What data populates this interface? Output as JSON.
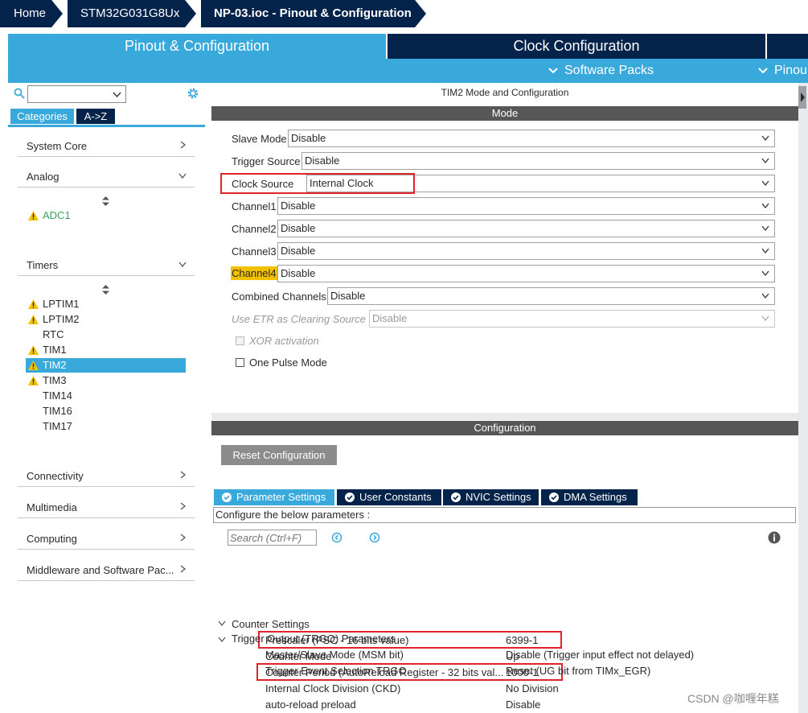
{
  "breadcrumb": {
    "home": "Home",
    "device": "STM32G031G8Ux",
    "project": "NP-03.ioc - Pinout & Configuration"
  },
  "tabs": {
    "pinout": "Pinout & Configuration",
    "clock": "Clock Configuration",
    "software_packs": "Software Packs",
    "pinout_menu": "Pinou"
  },
  "sidebar": {
    "search_value": "",
    "tab_categories": "Categories",
    "tab_az": "A->Z",
    "categories": {
      "system_core": "System Core",
      "analog": "Analog",
      "timers": "Timers",
      "connectivity": "Connectivity",
      "multimedia": "Multimedia",
      "computing": "Computing",
      "middleware": "Middleware and Software Pac..."
    },
    "analog_items": [
      {
        "label": "ADC1",
        "warning": true
      }
    ],
    "timer_items": [
      {
        "label": "LPTIM1",
        "warning": true
      },
      {
        "label": "LPTIM2",
        "warning": true
      },
      {
        "label": "RTC",
        "warning": false
      },
      {
        "label": "TIM1",
        "warning": true
      },
      {
        "label": "TIM2",
        "warning": true,
        "selected": true
      },
      {
        "label": "TIM3",
        "warning": true
      },
      {
        "label": "TIM14",
        "warning": false
      },
      {
        "label": "TIM16",
        "warning": false
      },
      {
        "label": "TIM17",
        "warning": false
      }
    ]
  },
  "mode": {
    "header": "TIM2 Mode and Configuration",
    "title": "Mode",
    "fields": {
      "slave_mode": {
        "label": "Slave Mode",
        "value": "Disable"
      },
      "trigger_source": {
        "label": "Trigger Source",
        "value": "Disable"
      },
      "clock_source": {
        "label": "Clock Source",
        "value": "Internal Clock"
      },
      "channel1": {
        "label": "Channel1",
        "value": "Disable"
      },
      "channel2": {
        "label": "Channel2",
        "value": "Disable"
      },
      "channel3": {
        "label": "Channel3",
        "value": "Disable"
      },
      "channel4": {
        "label": "Channel4",
        "value": "Disable"
      },
      "combined": {
        "label": "Combined Channels",
        "value": "Disable"
      },
      "etr": {
        "label": "Use ETR as Clearing Source",
        "value": "Disable"
      }
    },
    "xor_label": "XOR activation",
    "one_pulse_label": "One Pulse Mode"
  },
  "config": {
    "title": "Configuration",
    "reset_button": "Reset Configuration",
    "tabs": {
      "parameter": "Parameter Settings",
      "user_constants": "User Constants",
      "nvic": "NVIC Settings",
      "dma": "DMA Settings"
    },
    "hint": "Configure the below parameters :",
    "search_placeholder": "Search (Ctrl+F)",
    "groups": {
      "counter": "Counter Settings",
      "trgo": "Trigger Output (TRGO) Parameters"
    },
    "params": {
      "prescaler": {
        "name": "Prescaler (PSC - 16 bits value)",
        "value": "6399-1"
      },
      "counter_mode": {
        "name": "Counter Mode",
        "value": "Up"
      },
      "counter_period": {
        "name": "Counter Period (AutoReload Register - 32 bits val...",
        "value": "1000-1"
      },
      "ckd": {
        "name": "Internal Clock Division (CKD)",
        "value": "No Division"
      },
      "preload": {
        "name": "auto-reload preload",
        "value": "Disable"
      },
      "msm": {
        "name": "Master/Slave Mode (MSM bit)",
        "value": "Disable (Trigger input effect not delayed)"
      },
      "trgo_sel": {
        "name": "Trigger Event Selection TRGO",
        "value": "Reset (UG bit from TIMx_EGR)"
      }
    }
  },
  "watermark": "CSDN @咖喱年糕",
  "colors": {
    "navy": "#03234b",
    "accent_blue": "#39a9dc",
    "warning": "#f2c100",
    "highlight": "#e0242b",
    "adc_green": "#3a9f5a"
  }
}
